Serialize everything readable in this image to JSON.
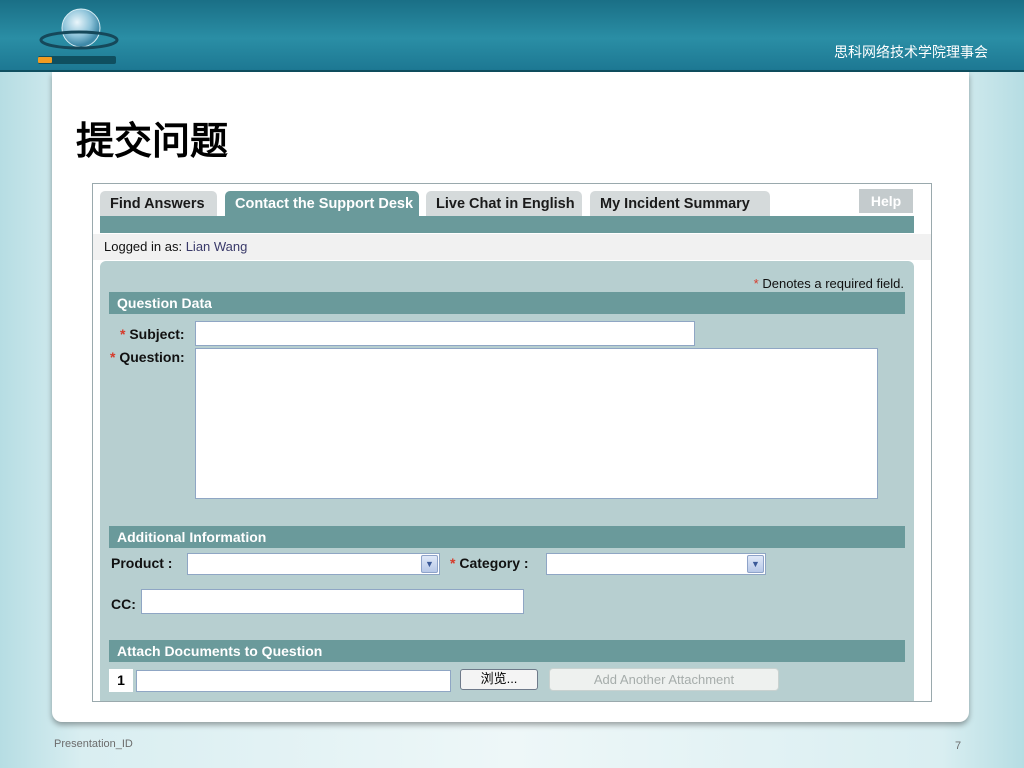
{
  "slide": {
    "org_name": "思科网络技术学院理事会",
    "title": "提交问题",
    "footer_left": "Presentation_ID",
    "page_number": "7",
    "colors": {
      "header_teal": "#1d7893",
      "tab_active": "#6a9a9b",
      "panel_bg": "#b7cfd0",
      "required_star": "#d63a2a"
    }
  },
  "tabs": [
    {
      "label": "Find Answers",
      "active": false
    },
    {
      "label": "Contact the Support Desk",
      "active": true
    },
    {
      "label": "Live Chat in English",
      "active": false
    },
    {
      "label": "My Incident Summary",
      "active": false
    }
  ],
  "help_label": "Help",
  "login": {
    "prefix": "Logged in as:",
    "user": "Lian Wang"
  },
  "required_note": {
    "star": "*",
    "text": "Denotes a required field."
  },
  "question_data": {
    "header": "Question Data",
    "subject_label": "Subject:",
    "question_label": "Question:",
    "subject_value": "",
    "question_value": ""
  },
  "additional_info": {
    "header": "Additional Information",
    "product_label": "Product :",
    "category_label": "Category :",
    "cc_label": "CC:",
    "product_value": "",
    "category_value": "",
    "cc_value": ""
  },
  "attachments": {
    "header": "Attach Documents to Question",
    "row_number": "1",
    "file_value": "",
    "browse_label": "浏览...",
    "add_label": "Add Another Attachment"
  },
  "icons": {
    "scroll_up": "scroll-up-arrow-icon",
    "scroll_down": "scroll-down-arrow-icon",
    "dropdown": "chevron-down-icon",
    "logo": "globe-logo-icon"
  }
}
